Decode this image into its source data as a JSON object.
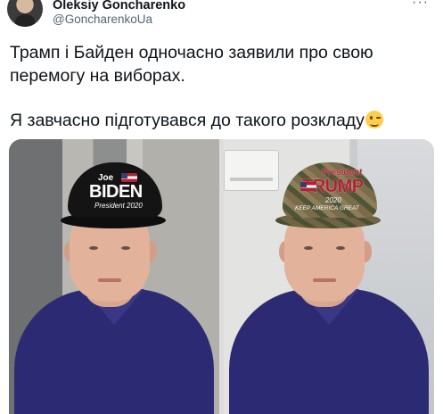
{
  "tweet": {
    "author": {
      "name": "Oleksiy Goncharenko",
      "handle": "@GoncharenkoUa"
    },
    "more_label": "···",
    "paragraphs": [
      "Трамп і Байден одночасно заявили про свою перемогу на виборах.",
      "Я завчасно підготувався до такого розкладу"
    ],
    "emoji": "winking-face"
  },
  "media": {
    "photos": [
      {
        "hat": "biden-cap",
        "hat_text": {
          "top": "Joe",
          "main": "BIDEN",
          "sub": "President 2020"
        }
      },
      {
        "hat": "trump-cap",
        "hat_text": {
          "top": "President",
          "main": "TRUMP",
          "sub": "2020",
          "bottom": "KEEP AMERICA GREAT"
        }
      }
    ]
  },
  "colors": {
    "text": "#0f1419",
    "secondary": "#536471",
    "shirt": "#2c2a72",
    "flag_red": "#b22234",
    "flag_blue": "#3c3b6e"
  }
}
